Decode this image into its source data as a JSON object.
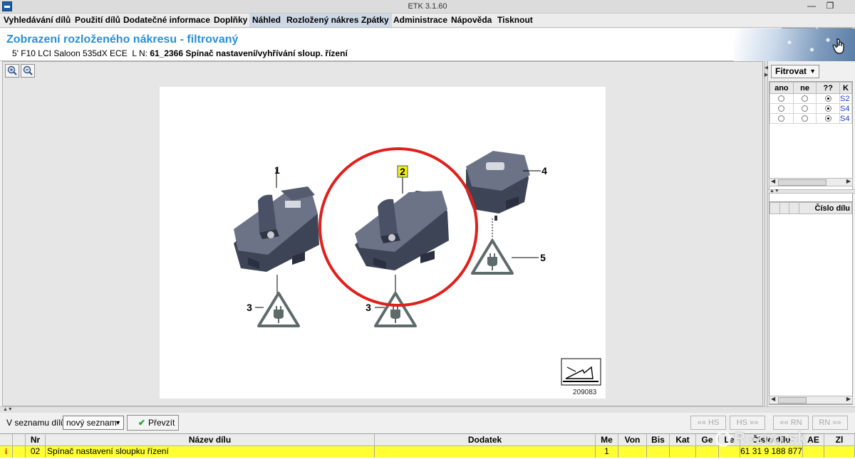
{
  "window": {
    "title": "ETK 3.1.60",
    "minimize_glyph": "—",
    "maximize_glyph": "❐"
  },
  "menu": [
    {
      "label": "Vyhledávání dílů",
      "active": false
    },
    {
      "label": "Použití dílů",
      "active": false
    },
    {
      "label": "Dodatečné informace",
      "active": false
    },
    {
      "label": "Doplňky",
      "active": false
    },
    {
      "label": "Náhled",
      "active": true
    },
    {
      "label": "Rozložený nákres",
      "active": true
    },
    {
      "label": "Zpátky",
      "active": true
    },
    {
      "label": "Administrace",
      "active": false
    },
    {
      "label": "Nápověda",
      "active": false
    },
    {
      "label": "Tisknout",
      "active": false
    }
  ],
  "header": {
    "title": "Zobrazení rozloženého nákresu - filtrovaný",
    "vehicle": "5' F10 LCI Saloon 535dX ECE",
    "ln_label": "L N:",
    "ln_value": "61_2366 Spínač nastavení/vyhřívání sloup. řízení"
  },
  "drawing": {
    "callouts": [
      "1",
      "2",
      "3",
      "3",
      "4",
      "5"
    ],
    "drawing_number": "209083",
    "highlight_color": "#e0201c",
    "part_color": "#3d4456"
  },
  "filter": {
    "dropdown_label": "Fitrovat",
    "columns": [
      "ano",
      "ne",
      "??",
      "K"
    ],
    "rows": [
      {
        "selected": "??",
        "code": "S2"
      },
      {
        "selected": "??",
        "code": "S4"
      },
      {
        "selected": "??",
        "code": "S4"
      }
    ],
    "list_header": "Číslo dílu"
  },
  "toolbar": {
    "list_label": "V seznamu dílů",
    "list_select": "nový seznam",
    "transfer_button": "Převzít",
    "nav_buttons": [
      "«« HS",
      "HS »»",
      "«« RN",
      "RN »»"
    ]
  },
  "parts": {
    "columns": [
      "Nr",
      "Název dílu",
      "Dodatek",
      "Me",
      "Von",
      "Bis",
      "Kat",
      "Ge",
      "Le",
      "Číslo dílu",
      "AE",
      "Zl"
    ],
    "rows": [
      {
        "info": "i",
        "nr": "02",
        "name": "Spínač nastavení sloupku řízení",
        "addition": "",
        "me": "1",
        "part_number": "61 31 9 188 877"
      }
    ]
  },
  "watermark": "Rozoo.sk"
}
